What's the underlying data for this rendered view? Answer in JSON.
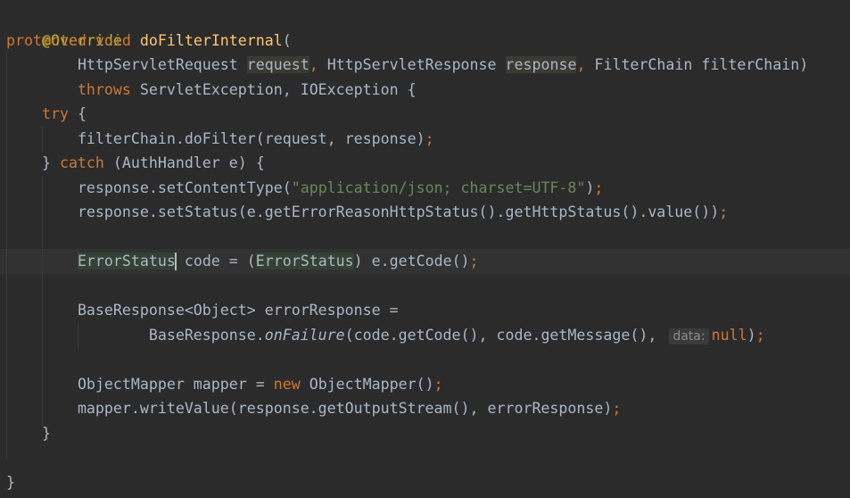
{
  "code": {
    "annotation": "@Override",
    "kw_protected": "protected",
    "kw_void": "void",
    "method_name": "doFilterInternal",
    "open_paren": "(",
    "type_request": "HttpServletRequest",
    "param_request": "request",
    "type_response": "HttpServletResponse",
    "param_response": "response",
    "filter_chain_params": "FilterChain filterChain)",
    "kw_throws": "throws",
    "exceptions": " ServletException, IOException {",
    "kw_try": "try",
    "open_brace": " {",
    "do_filter_call": "filterChain.doFilter(request, response)",
    "semicolon": ";",
    "close_brace_catch": "} ",
    "kw_catch": "catch",
    "catch_clause": " (AuthHandler e) {",
    "set_content_type_pre": "response.setContentType(",
    "content_type_value": "\"application/json; charset=UTF-8\"",
    "close_paren_semicolon": ");",
    "set_status_call": "response.setStatus(e.getErrorReasonHttpStatus().getHttpStatus().value())",
    "error_status_type": "ErrorStatus",
    "code_assign_pre": " code = (",
    "code_assign_post": ") e.getCode()",
    "base_response_decl": "BaseResponse<Object> errorResponse =",
    "base_response_class": "BaseResponse.",
    "on_failure": "onFailure",
    "on_failure_args": "(code.getCode(), code.getMessage(),",
    "param_hint": "data:",
    "kw_null": "null",
    "close_paren": ")",
    "mapper_decl_pre": "ObjectMapper mapper = ",
    "kw_new": "new",
    "mapper_decl_post": " ObjectMapper()",
    "write_value_call": "mapper.writeValue(response.getOutputStream(), errorResponse)",
    "close_brace": "}",
    "comma_space": ", ",
    "comma": ","
  }
}
